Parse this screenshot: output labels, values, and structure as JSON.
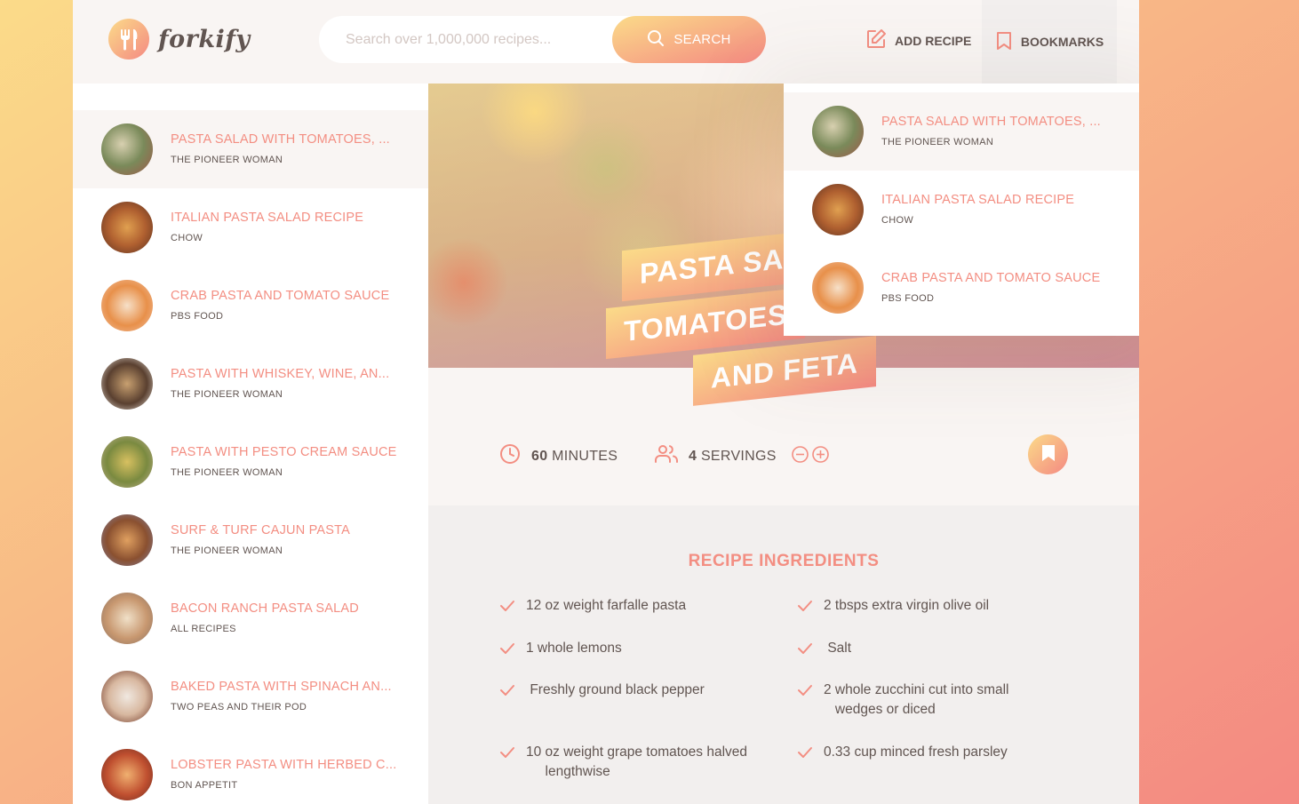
{
  "app": {
    "logo_text": "forkify"
  },
  "search": {
    "placeholder": "Search over 1,000,000 recipes...",
    "button_label": "SEARCH"
  },
  "nav": {
    "add_recipe_label": "ADD RECIPE",
    "bookmarks_label": "BOOKMARKS"
  },
  "results": [
    {
      "title": "PASTA SALAD WITH TOMATOES, ...",
      "publisher": "THE PIONEER WOMAN"
    },
    {
      "title": "ITALIAN PASTA SALAD RECIPE",
      "publisher": "CHOW"
    },
    {
      "title": "CRAB PASTA AND TOMATO SAUCE",
      "publisher": "PBS FOOD"
    },
    {
      "title": "PASTA WITH WHISKEY, WINE, AN...",
      "publisher": "THE PIONEER WOMAN"
    },
    {
      "title": "PASTA WITH PESTO CREAM SAUCE",
      "publisher": "THE PIONEER WOMAN"
    },
    {
      "title": "SURF & TURF CAJUN PASTA",
      "publisher": "THE PIONEER WOMAN"
    },
    {
      "title": "BACON RANCH PASTA SALAD",
      "publisher": "ALL RECIPES"
    },
    {
      "title": "BAKED PASTA WITH SPINACH AN...",
      "publisher": "TWO PEAS AND THEIR POD"
    },
    {
      "title": "LOBSTER PASTA WITH HERBED C...",
      "publisher": "BON APPETIT"
    }
  ],
  "bookmarks": [
    {
      "title": "PASTA SALAD WITH TOMATOES, ...",
      "publisher": "THE PIONEER WOMAN"
    },
    {
      "title": "ITALIAN PASTA SALAD RECIPE",
      "publisher": "CHOW"
    },
    {
      "title": "CRAB PASTA AND TOMATO SAUCE",
      "publisher": "PBS FOOD"
    }
  ],
  "recipe": {
    "title_lines": [
      "PASTA SALAD WITH",
      "TOMATOES",
      "AND FETA"
    ],
    "cooking_time": "60",
    "time_unit": "MINUTES",
    "servings": "4",
    "servings_unit": "SERVINGS",
    "ingredients_heading": "RECIPE INGREDIENTS",
    "ingredients": [
      "12 oz weight farfalle pasta",
      "2 tbsps extra virgin olive oil",
      "1 whole lemons",
      " Salt",
      " Freshly ground black pepper",
      "2 whole zucchini cut into small\n   wedges or diced",
      "10 oz weight grape tomatoes halved\n     lengthwise",
      "0.33 cup minced fresh parsley"
    ]
  },
  "colors": {
    "accent": "#f38e82",
    "grad_start": "#fbdb89",
    "grad_end": "#f48982",
    "text": "#615551"
  }
}
